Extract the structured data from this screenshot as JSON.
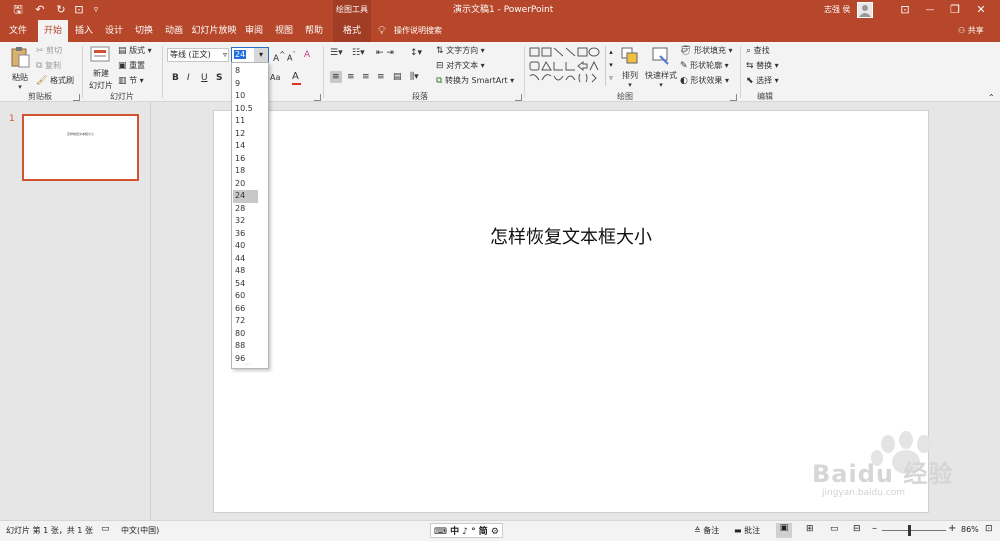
{
  "titlebar": {
    "context_title": "绘图工具",
    "doc_title": "演示文稿1 - PowerPoint",
    "user": "志强 侯",
    "qat": {
      "save": "🖫",
      "undo": "↶",
      "redo": "↻",
      "present": "⊡",
      "more": "▿"
    },
    "window": {
      "ribbon_opts": "⊡",
      "min": "—",
      "max": "❐",
      "close": "✕"
    }
  },
  "tabs": [
    {
      "label": "文件"
    },
    {
      "label": "开始"
    },
    {
      "label": "插入"
    },
    {
      "label": "设计"
    },
    {
      "label": "切换"
    },
    {
      "label": "动画"
    },
    {
      "label": "幻灯片放映"
    },
    {
      "label": "审阅"
    },
    {
      "label": "视图"
    },
    {
      "label": "帮助"
    },
    {
      "label": "格式"
    }
  ],
  "tell_me": "操作说明搜索",
  "share": "共享",
  "clipboard": {
    "paste": "粘贴",
    "cut": "剪切",
    "copy": "复制",
    "format_painter": "格式刷",
    "group": "剪贴板"
  },
  "slides": {
    "new_slide_1": "新建",
    "new_slide_2": "幻灯片",
    "layout": "版式",
    "reset": "重置",
    "section": "节",
    "group": "幻灯片"
  },
  "font": {
    "name": "等线 (正文)",
    "size": "24",
    "bold": "B",
    "italic": "I",
    "underline": "U",
    "strike": "S",
    "grow": "A",
    "shrink": "A",
    "clear": "A",
    "color": "A",
    "aa": "Aa"
  },
  "paragraph": {
    "text_direction": "文字方向",
    "align_text": "对齐文本",
    "smartart": "转换为 SmartArt",
    "group": "段落"
  },
  "drawing": {
    "arrange": "排列",
    "quick_styles": "快速样式",
    "fill": "形状填充",
    "outline": "形状轮廓",
    "effects": "形状效果",
    "group": "绘图"
  },
  "editing": {
    "find": "查找",
    "replace": "替换",
    "select": "选择",
    "group": "编辑"
  },
  "font_sizes": [
    "8",
    "9",
    "10",
    "10.5",
    "11",
    "12",
    "14",
    "16",
    "18",
    "20",
    "24",
    "28",
    "32",
    "36",
    "40",
    "44",
    "48",
    "54",
    "60",
    "66",
    "72",
    "80",
    "88",
    "96"
  ],
  "selected_size": "24",
  "thumbnail": {
    "number": "1",
    "text": "怎样恢复文本框大小"
  },
  "slide": {
    "title": "怎样恢复文本框大小"
  },
  "status": {
    "slide_info": "幻灯片 第 1 张，共 1 张",
    "language": "中文(中国)",
    "notes": "备注",
    "comments": "批注",
    "zoom": "86%",
    "ime": "中 ♪ ° 简"
  },
  "watermark": {
    "line1": "Baidu 经验",
    "line2": "jingyan.baidu.com"
  }
}
